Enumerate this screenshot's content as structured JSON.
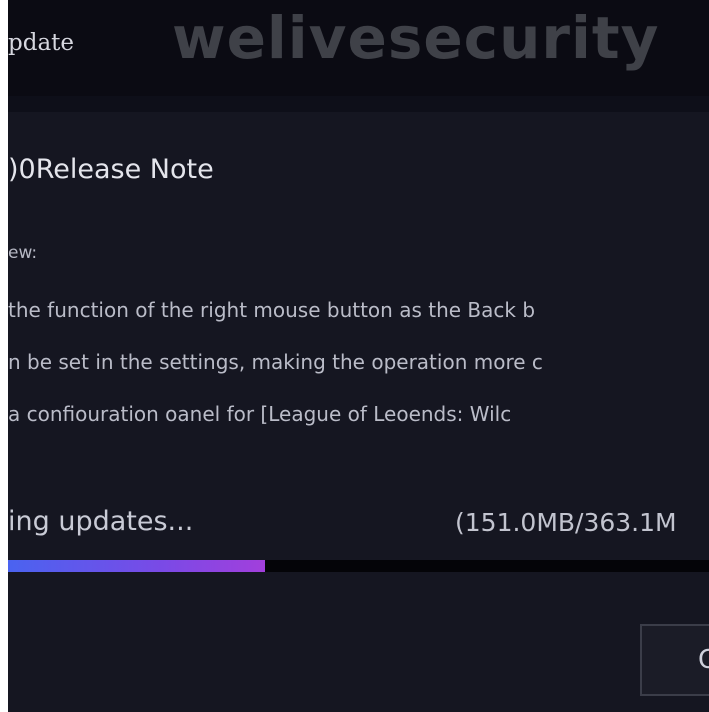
{
  "window": {
    "title": "pdate",
    "watermark": "welivesecurity"
  },
  "release": {
    "title": ")0Release Note",
    "new_label": "ew:",
    "notes": [
      " the function of the right mouse button as the Back b",
      "n be set in the settings, making the operation more c",
      " a confiouration oanel for  [League of Leoends: Wilc"
    ]
  },
  "download": {
    "status": "ing updates...",
    "size": "(151.0MB/363.1M",
    "progress": 0.366,
    "colors": {
      "start": "#4a63f0",
      "end": "#a23fdc",
      "track": "#040408"
    }
  },
  "button": {
    "label": "C"
  }
}
